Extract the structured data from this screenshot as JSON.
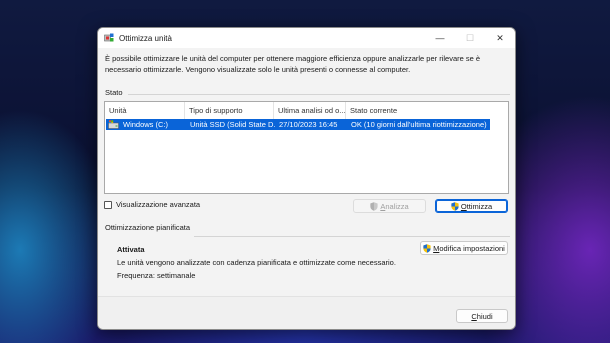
{
  "window": {
    "title": "Ottimizza unità",
    "controls": {
      "minimize": "—",
      "maximize": "☐",
      "close": "✕"
    }
  },
  "intro": {
    "line1": "È possibile ottimizzare le unità del computer per ottenere maggiore efficienza oppure analizzarle per rilevare se è",
    "line2": "necessario ottimizzarle. Vengono visualizzate solo le unità presenti o connesse al computer."
  },
  "status_section": {
    "label": "Stato"
  },
  "drives_table": {
    "columns": [
      "Unità",
      "Tipo di supporto",
      "Ultima analisi od o...",
      "Stato corrente"
    ],
    "rows": [
      {
        "icon": "drive-icon",
        "unit": "Windows (C:)",
        "media_type": "Unità SSD (Solid State D...",
        "last_analysis": "27/10/2023 16:45",
        "current_status": "OK (10 giorni dall'ultima riottimizzazione)"
      }
    ]
  },
  "advanced_view": {
    "label": "Visualizzazione avanzata",
    "checked": false
  },
  "buttons": {
    "analyze": {
      "label_prefix": "",
      "accel": "A",
      "label_rest": "nalizza",
      "enabled": false
    },
    "optimize": {
      "label_prefix": "",
      "accel": "O",
      "label_rest": "ttimizza",
      "enabled": true
    },
    "change_settings": {
      "label_prefix": "",
      "accel": "M",
      "label_rest": "odifica impostazioni"
    },
    "close": {
      "label_prefix": "",
      "accel": "C",
      "label_rest": "hiudi"
    }
  },
  "scheduled": {
    "section_label": "Ottimizzazione pianificata",
    "state": "Attivata",
    "description": "Le unità vengono analizzate con cadenza pianificata e ottimizzate come necessario.",
    "frequency": "Frequenza: settimanale"
  },
  "colors": {
    "selection": "#0a64d8",
    "window_bg": "#f3f3f3",
    "accent_border": "#0a64d8"
  }
}
